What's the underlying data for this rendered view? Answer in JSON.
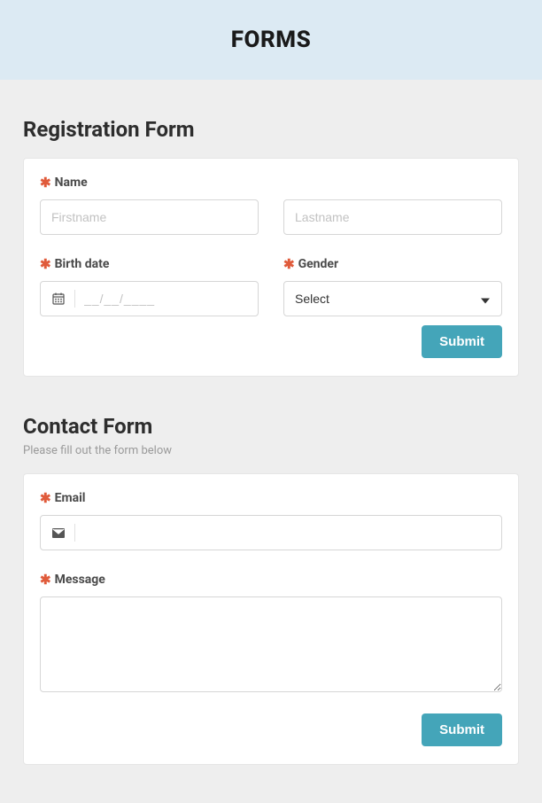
{
  "header": {
    "title": "FORMS"
  },
  "registration": {
    "title": "Registration Form",
    "name": {
      "label": "Name",
      "firstname_placeholder": "Firstname",
      "lastname_placeholder": "Lastname"
    },
    "birthdate": {
      "label": "Birth date",
      "placeholder": "__/__/____"
    },
    "gender": {
      "label": "Gender",
      "selected": "Select"
    },
    "submit_label": "Submit"
  },
  "contact": {
    "title": "Contact Form",
    "subtitle": "Please fill out the form below",
    "email": {
      "label": "Email",
      "value": ""
    },
    "message": {
      "label": "Message",
      "value": ""
    },
    "submit_label": "Submit"
  }
}
